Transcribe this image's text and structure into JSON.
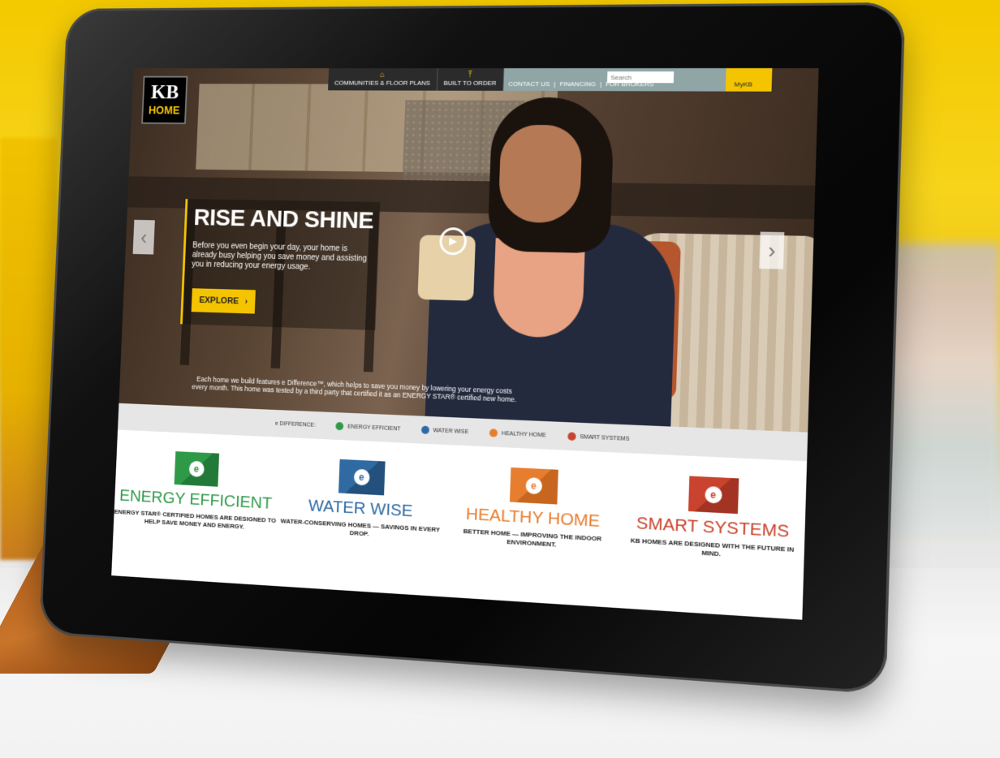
{
  "site": {
    "logo_kb": "KB",
    "logo_home": "HOME",
    "nav": {
      "communities": "COMMUNITIES & FLOOR PLANS",
      "built": "BUILT TO ORDER",
      "contact": "CONTACT US",
      "financing": "FINANCING",
      "brokers": "FOR BROKERS",
      "separator": "|",
      "search_placeholder": "Search",
      "mykb": "MyKB"
    },
    "hero": {
      "title": "RISE AND SHINE",
      "body": "Before you even begin your day, your home is already busy helping you save money and assisting you in reducing your energy usage.",
      "cta": "EXPLORE",
      "caption": "Each home we build features e Difference™, which helps to save you money by lowering your energy costs every month. This home was tested by a third party that certified it as an ENERGY STAR® certified new home."
    },
    "ebar": {
      "label": "e DIFFERENCE:",
      "items": [
        "ENERGY EFFICIENT",
        "WATER WISE",
        "HEALTHY HOME",
        "SMART SYSTEMS"
      ]
    },
    "features": [
      {
        "title": "ENERGY EFFICIENT",
        "body": "ENERGY STAR® CERTIFIED HOMES ARE DESIGNED TO HELP SAVE MONEY AND ENERGY.",
        "color": "#2e9a48"
      },
      {
        "title": "WATER WISE",
        "body": "WATER-CONSERVING HOMES — SAVINGS IN EVERY DROP.",
        "color": "#2f6aa3"
      },
      {
        "title": "HEALTHY HOME",
        "body": "BETTER HOME — IMPROVING THE INDOOR ENVIRONMENT.",
        "color": "#e77d2e"
      },
      {
        "title": "SMART SYSTEMS",
        "body": "KB HOMES ARE DESIGNED WITH THE FUTURE IN MIND.",
        "color": "#c9432e"
      }
    ],
    "colors": {
      "accent": "#f5c400"
    }
  }
}
